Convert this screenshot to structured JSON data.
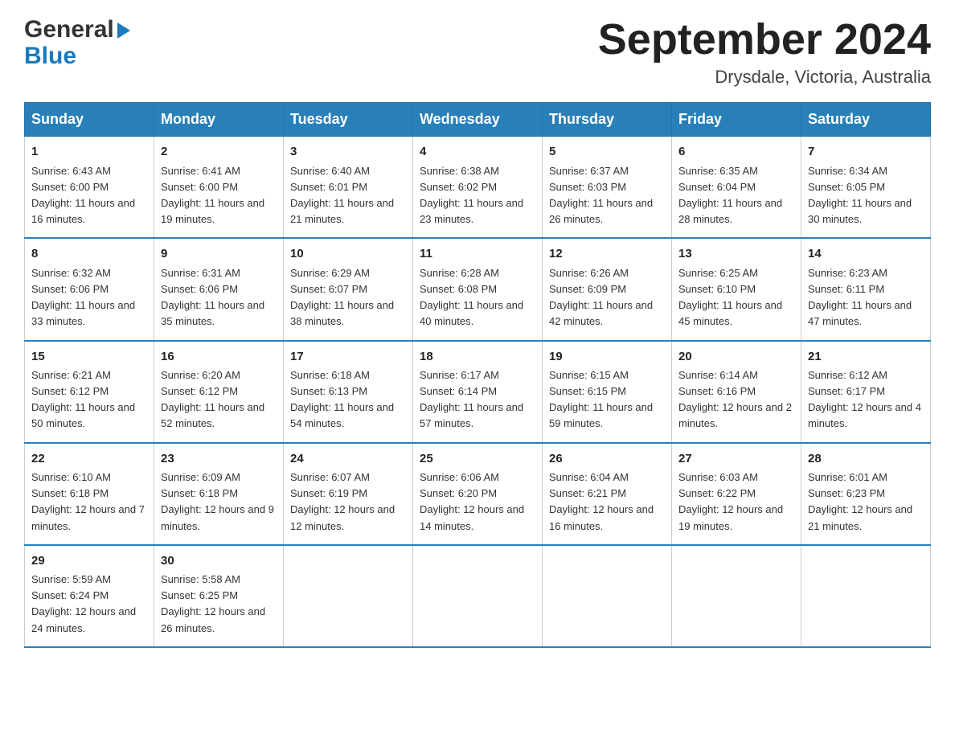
{
  "header": {
    "logo": {
      "text_general": "General",
      "text_blue": "Blue",
      "arrow": "▶"
    },
    "title": "September 2024",
    "subtitle": "Drysdale, Victoria, Australia"
  },
  "days_of_week": [
    "Sunday",
    "Monday",
    "Tuesday",
    "Wednesday",
    "Thursday",
    "Friday",
    "Saturday"
  ],
  "weeks": [
    [
      {
        "day": "1",
        "sunrise": "Sunrise: 6:43 AM",
        "sunset": "Sunset: 6:00 PM",
        "daylight": "Daylight: 11 hours and 16 minutes."
      },
      {
        "day": "2",
        "sunrise": "Sunrise: 6:41 AM",
        "sunset": "Sunset: 6:00 PM",
        "daylight": "Daylight: 11 hours and 19 minutes."
      },
      {
        "day": "3",
        "sunrise": "Sunrise: 6:40 AM",
        "sunset": "Sunset: 6:01 PM",
        "daylight": "Daylight: 11 hours and 21 minutes."
      },
      {
        "day": "4",
        "sunrise": "Sunrise: 6:38 AM",
        "sunset": "Sunset: 6:02 PM",
        "daylight": "Daylight: 11 hours and 23 minutes."
      },
      {
        "day": "5",
        "sunrise": "Sunrise: 6:37 AM",
        "sunset": "Sunset: 6:03 PM",
        "daylight": "Daylight: 11 hours and 26 minutes."
      },
      {
        "day": "6",
        "sunrise": "Sunrise: 6:35 AM",
        "sunset": "Sunset: 6:04 PM",
        "daylight": "Daylight: 11 hours and 28 minutes."
      },
      {
        "day": "7",
        "sunrise": "Sunrise: 6:34 AM",
        "sunset": "Sunset: 6:05 PM",
        "daylight": "Daylight: 11 hours and 30 minutes."
      }
    ],
    [
      {
        "day": "8",
        "sunrise": "Sunrise: 6:32 AM",
        "sunset": "Sunset: 6:06 PM",
        "daylight": "Daylight: 11 hours and 33 minutes."
      },
      {
        "day": "9",
        "sunrise": "Sunrise: 6:31 AM",
        "sunset": "Sunset: 6:06 PM",
        "daylight": "Daylight: 11 hours and 35 minutes."
      },
      {
        "day": "10",
        "sunrise": "Sunrise: 6:29 AM",
        "sunset": "Sunset: 6:07 PM",
        "daylight": "Daylight: 11 hours and 38 minutes."
      },
      {
        "day": "11",
        "sunrise": "Sunrise: 6:28 AM",
        "sunset": "Sunset: 6:08 PM",
        "daylight": "Daylight: 11 hours and 40 minutes."
      },
      {
        "day": "12",
        "sunrise": "Sunrise: 6:26 AM",
        "sunset": "Sunset: 6:09 PM",
        "daylight": "Daylight: 11 hours and 42 minutes."
      },
      {
        "day": "13",
        "sunrise": "Sunrise: 6:25 AM",
        "sunset": "Sunset: 6:10 PM",
        "daylight": "Daylight: 11 hours and 45 minutes."
      },
      {
        "day": "14",
        "sunrise": "Sunrise: 6:23 AM",
        "sunset": "Sunset: 6:11 PM",
        "daylight": "Daylight: 11 hours and 47 minutes."
      }
    ],
    [
      {
        "day": "15",
        "sunrise": "Sunrise: 6:21 AM",
        "sunset": "Sunset: 6:12 PM",
        "daylight": "Daylight: 11 hours and 50 minutes."
      },
      {
        "day": "16",
        "sunrise": "Sunrise: 6:20 AM",
        "sunset": "Sunset: 6:12 PM",
        "daylight": "Daylight: 11 hours and 52 minutes."
      },
      {
        "day": "17",
        "sunrise": "Sunrise: 6:18 AM",
        "sunset": "Sunset: 6:13 PM",
        "daylight": "Daylight: 11 hours and 54 minutes."
      },
      {
        "day": "18",
        "sunrise": "Sunrise: 6:17 AM",
        "sunset": "Sunset: 6:14 PM",
        "daylight": "Daylight: 11 hours and 57 minutes."
      },
      {
        "day": "19",
        "sunrise": "Sunrise: 6:15 AM",
        "sunset": "Sunset: 6:15 PM",
        "daylight": "Daylight: 11 hours and 59 minutes."
      },
      {
        "day": "20",
        "sunrise": "Sunrise: 6:14 AM",
        "sunset": "Sunset: 6:16 PM",
        "daylight": "Daylight: 12 hours and 2 minutes."
      },
      {
        "day": "21",
        "sunrise": "Sunrise: 6:12 AM",
        "sunset": "Sunset: 6:17 PM",
        "daylight": "Daylight: 12 hours and 4 minutes."
      }
    ],
    [
      {
        "day": "22",
        "sunrise": "Sunrise: 6:10 AM",
        "sunset": "Sunset: 6:18 PM",
        "daylight": "Daylight: 12 hours and 7 minutes."
      },
      {
        "day": "23",
        "sunrise": "Sunrise: 6:09 AM",
        "sunset": "Sunset: 6:18 PM",
        "daylight": "Daylight: 12 hours and 9 minutes."
      },
      {
        "day": "24",
        "sunrise": "Sunrise: 6:07 AM",
        "sunset": "Sunset: 6:19 PM",
        "daylight": "Daylight: 12 hours and 12 minutes."
      },
      {
        "day": "25",
        "sunrise": "Sunrise: 6:06 AM",
        "sunset": "Sunset: 6:20 PM",
        "daylight": "Daylight: 12 hours and 14 minutes."
      },
      {
        "day": "26",
        "sunrise": "Sunrise: 6:04 AM",
        "sunset": "Sunset: 6:21 PM",
        "daylight": "Daylight: 12 hours and 16 minutes."
      },
      {
        "day": "27",
        "sunrise": "Sunrise: 6:03 AM",
        "sunset": "Sunset: 6:22 PM",
        "daylight": "Daylight: 12 hours and 19 minutes."
      },
      {
        "day": "28",
        "sunrise": "Sunrise: 6:01 AM",
        "sunset": "Sunset: 6:23 PM",
        "daylight": "Daylight: 12 hours and 21 minutes."
      }
    ],
    [
      {
        "day": "29",
        "sunrise": "Sunrise: 5:59 AM",
        "sunset": "Sunset: 6:24 PM",
        "daylight": "Daylight: 12 hours and 24 minutes."
      },
      {
        "day": "30",
        "sunrise": "Sunrise: 5:58 AM",
        "sunset": "Sunset: 6:25 PM",
        "daylight": "Daylight: 12 hours and 26 minutes."
      },
      null,
      null,
      null,
      null,
      null
    ]
  ]
}
